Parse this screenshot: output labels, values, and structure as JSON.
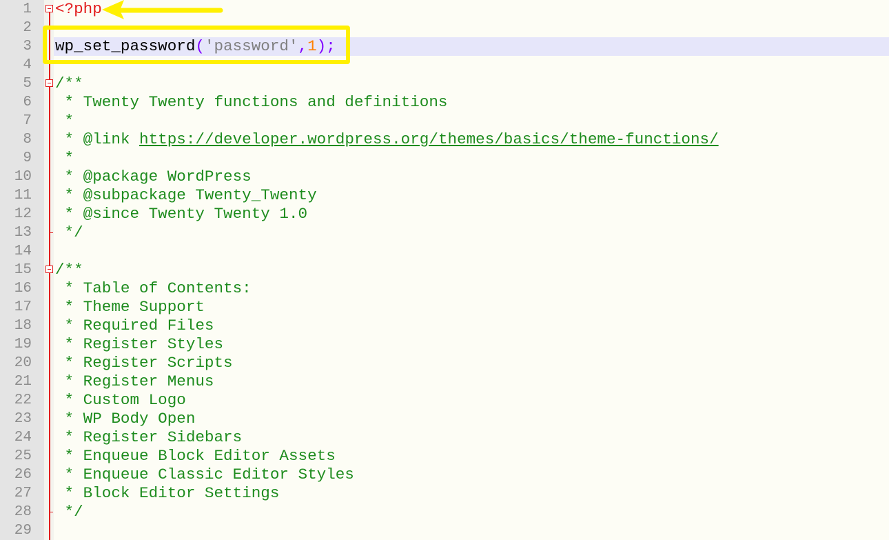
{
  "editor": {
    "language": "php",
    "current_line": 3,
    "colors": {
      "background": "#fdfdf5",
      "gutter": "#e4e4e4",
      "line_numbers": "#8c8c8c",
      "fold_marker": "#e21d1d",
      "current_line_highlight": "#e6e6fa",
      "php_tag": "#e21d1d",
      "operator": "#8000ff",
      "string": "#808080",
      "number": "#ff8000",
      "comment": "#1e8c1e",
      "annotation": "#fff000"
    },
    "lines": [
      {
        "n": "1",
        "fold": "open",
        "tokens": [
          {
            "t": "<?php",
            "c": "php"
          }
        ]
      },
      {
        "n": "2",
        "tokens": []
      },
      {
        "n": "3",
        "tokens": [
          {
            "t": "wp_set_password",
            "c": "fn"
          },
          {
            "t": "(",
            "c": "op"
          },
          {
            "t": "'password'",
            "c": "str"
          },
          {
            "t": ",",
            "c": "op"
          },
          {
            "t": "1",
            "c": "num"
          },
          {
            "t": ");",
            "c": "op"
          }
        ]
      },
      {
        "n": "4",
        "tokens": []
      },
      {
        "n": "5",
        "fold": "open",
        "tokens": [
          {
            "t": "/**",
            "c": "cmt"
          }
        ]
      },
      {
        "n": "6",
        "tokens": [
          {
            "t": " * Twenty Twenty functions and definitions",
            "c": "cmt"
          }
        ]
      },
      {
        "n": "7",
        "tokens": [
          {
            "t": " *",
            "c": "cmt"
          }
        ]
      },
      {
        "n": "8",
        "tokens": [
          {
            "t": " * @link ",
            "c": "cmt"
          },
          {
            "t": "https://developer.wordpress.org/themes/basics/theme-functions/",
            "c": "link"
          }
        ]
      },
      {
        "n": "9",
        "tokens": [
          {
            "t": " *",
            "c": "cmt"
          }
        ]
      },
      {
        "n": "10",
        "tokens": [
          {
            "t": " * @package WordPress",
            "c": "cmt"
          }
        ]
      },
      {
        "n": "11",
        "tokens": [
          {
            "t": " * @subpackage Twenty_Twenty",
            "c": "cmt"
          }
        ]
      },
      {
        "n": "12",
        "tokens": [
          {
            "t": " * @since Twenty Twenty 1.0",
            "c": "cmt"
          }
        ]
      },
      {
        "n": "13",
        "fold": "end",
        "tokens": [
          {
            "t": " */",
            "c": "cmt"
          }
        ]
      },
      {
        "n": "14",
        "tokens": []
      },
      {
        "n": "15",
        "fold": "open",
        "tokens": [
          {
            "t": "/**",
            "c": "cmt"
          }
        ]
      },
      {
        "n": "16",
        "tokens": [
          {
            "t": " * Table of Contents:",
            "c": "cmt"
          }
        ]
      },
      {
        "n": "17",
        "tokens": [
          {
            "t": " * Theme Support",
            "c": "cmt"
          }
        ]
      },
      {
        "n": "18",
        "tokens": [
          {
            "t": " * Required Files",
            "c": "cmt"
          }
        ]
      },
      {
        "n": "19",
        "tokens": [
          {
            "t": " * Register Styles",
            "c": "cmt"
          }
        ]
      },
      {
        "n": "20",
        "tokens": [
          {
            "t": " * Register Scripts",
            "c": "cmt"
          }
        ]
      },
      {
        "n": "21",
        "tokens": [
          {
            "t": " * Register Menus",
            "c": "cmt"
          }
        ]
      },
      {
        "n": "22",
        "tokens": [
          {
            "t": " * Custom Logo",
            "c": "cmt"
          }
        ]
      },
      {
        "n": "23",
        "tokens": [
          {
            "t": " * WP Body Open",
            "c": "cmt"
          }
        ]
      },
      {
        "n": "24",
        "tokens": [
          {
            "t": " * Register Sidebars",
            "c": "cmt"
          }
        ]
      },
      {
        "n": "25",
        "tokens": [
          {
            "t": " * Enqueue Block Editor Assets",
            "c": "cmt"
          }
        ]
      },
      {
        "n": "26",
        "tokens": [
          {
            "t": " * Enqueue Classic Editor Styles",
            "c": "cmt"
          }
        ]
      },
      {
        "n": "27",
        "tokens": [
          {
            "t": " * Block Editor Settings",
            "c": "cmt"
          }
        ]
      },
      {
        "n": "28",
        "fold": "end",
        "tokens": [
          {
            "t": " */",
            "c": "cmt"
          }
        ]
      },
      {
        "n": "29",
        "tokens": []
      }
    ]
  },
  "annotations": {
    "highlight_box": "line-3-highlight",
    "arrow": "points-to-php-open-tag"
  }
}
